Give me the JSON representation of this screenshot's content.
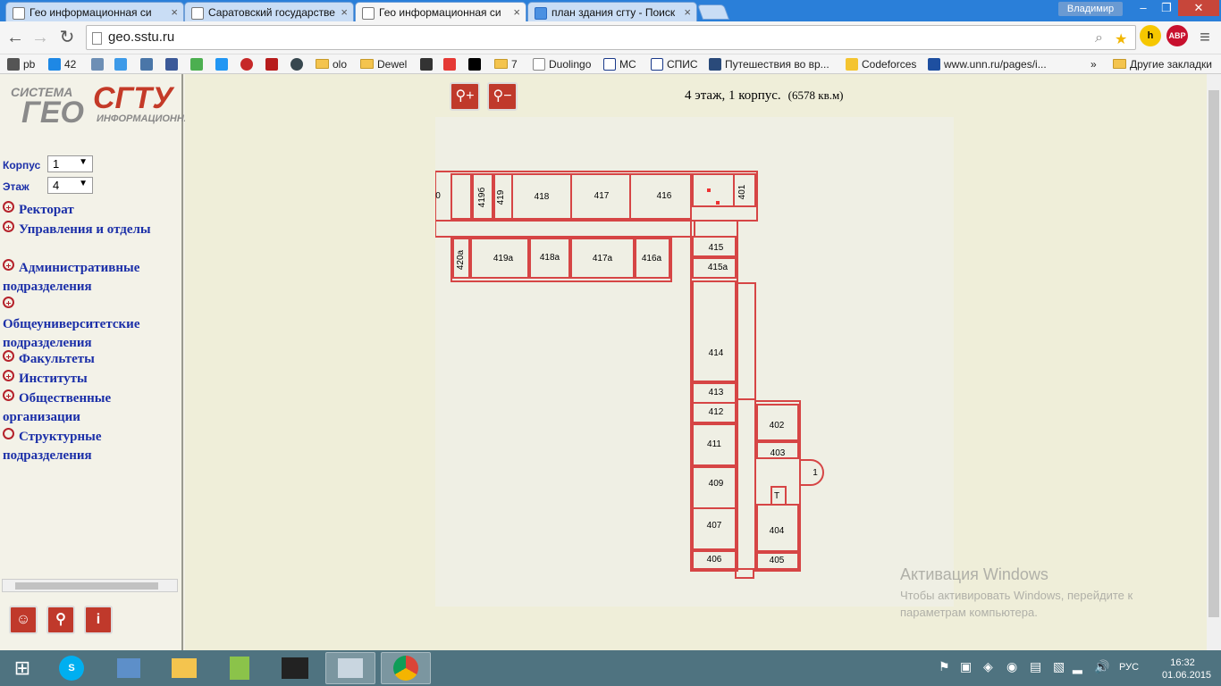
{
  "browser": {
    "tabs": [
      {
        "label": "Гео информационная си"
      },
      {
        "label": "Саратовский государстве"
      },
      {
        "label": "Гео информационная си"
      },
      {
        "label": "план здания сгту - Поиск"
      }
    ],
    "user": "Владимир",
    "url": "geo.sstu.ru",
    "extensions": {
      "h": "h",
      "abp": "ABP"
    },
    "bookmarks": [
      "pb",
      "42",
      "olo",
      "Dewel",
      "7",
      "Duolingo",
      "MC",
      "СПИС",
      "Путешествия во вр...",
      "Codeforces",
      "www.unn.ru/pages/i...",
      "»",
      "Другие закладки"
    ]
  },
  "sidebar": {
    "logo": {
      "line1": "СИСТЕМА",
      "line2": "ГЕО",
      "line3": "СГТУ",
      "line4": "ИНФОРМАЦИОННАЯ"
    },
    "korpus_label": "Корпус",
    "korpus_value": "1",
    "etazh_label": "Этаж",
    "etazh_value": "4",
    "menu": [
      {
        "label": "Ректорат",
        "expandable": true
      },
      {
        "label": "Управления и отделы",
        "expandable": true
      },
      {
        "label": "Административные подразделения",
        "expandable": true
      },
      {
        "label": "Общеуниверситетские подразделения",
        "expandable": true
      },
      {
        "label": "Факультеты",
        "expandable": true
      },
      {
        "label": "Институты",
        "expandable": true
      },
      {
        "label": "Общественные организации",
        "expandable": true
      },
      {
        "label": "Структурные подразделения",
        "expandable": false
      }
    ]
  },
  "main": {
    "floor_title": "4 этаж, 1 корпус.",
    "floor_area": "(6578 кв.м)",
    "rooms": [
      "0",
      "419б",
      "419",
      "418",
      "417",
      "416",
      "401",
      "420а",
      "419а",
      "418а",
      "417а",
      "416а",
      "415",
      "415а",
      "414",
      "413",
      "412",
      "411",
      "409",
      "407",
      "406",
      "402",
      "403",
      "404",
      "405",
      "Т",
      "1"
    ]
  },
  "activation": {
    "title": "Активация Windows",
    "text": "Чтобы активировать Windows, перейдите к параметрам компьютера."
  },
  "taskbar": {
    "lang": "РУС",
    "time": "16:32",
    "date": "01.06.2015"
  }
}
